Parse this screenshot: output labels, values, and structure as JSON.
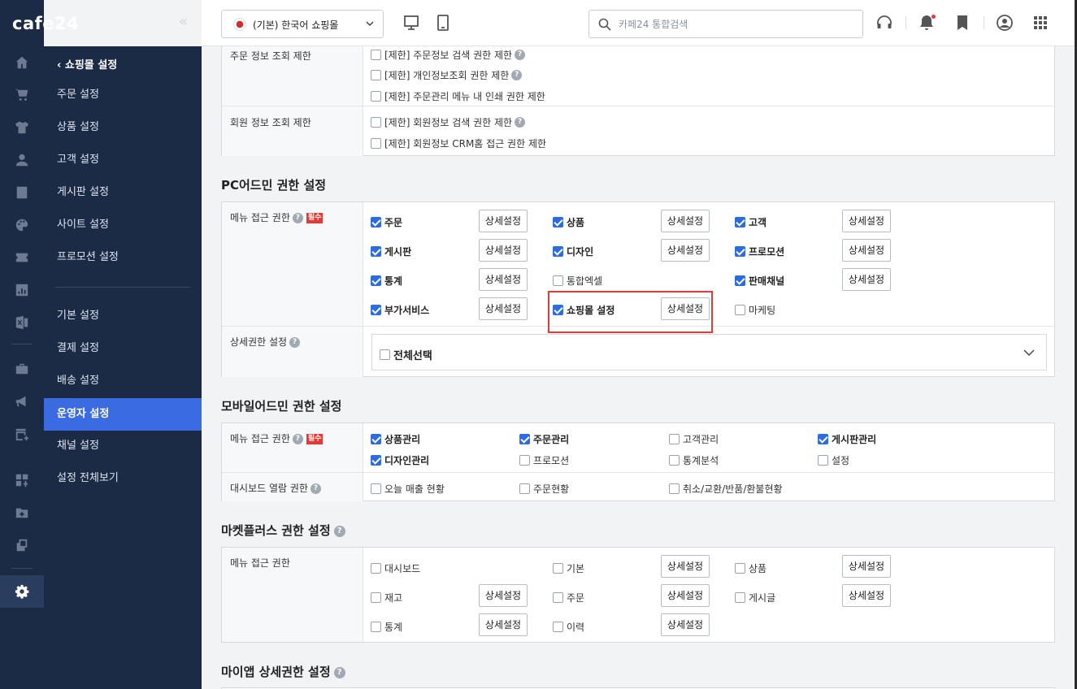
{
  "brand": {
    "logo": "cafe24",
    "collapse_icon": "«"
  },
  "topbar": {
    "store_select": "(기본) 한국어 쇼핑몰",
    "search_placeholder": "카페24 통합검색"
  },
  "sidebar": {
    "back_title": "쇼핑몰 설정",
    "items_top": [
      "주문 설정",
      "상품 설정",
      "고객 설정",
      "게시판 설정",
      "사이트 설정",
      "프로모션 설정"
    ],
    "items_bottom": [
      "기본 설정",
      "결제 설정",
      "배송 설정",
      "운영자 설정",
      "채널 설정",
      "설정 전체보기"
    ],
    "active": "운영자 설정"
  },
  "order_info": {
    "label": "주문 정보 조회 제한",
    "options": [
      "[제한] 주문정보 검색 권한 제한",
      "[제한] 개인정보조회 권한 제한",
      "[제한] 주문관리 메뉴 내 인쇄 권한 제한"
    ]
  },
  "member_info": {
    "label": "회원 정보 조회 제한",
    "options": [
      "[제한] 회원정보 검색 권한 제한",
      "[제한] 회원정보 CRM홈 접근 권한 제한"
    ]
  },
  "pc_admin": {
    "title": "PC어드민 권한 설정",
    "menu_label": "메뉴 접근 권한",
    "required": "필수",
    "detail_button": "상세설정",
    "items": [
      {
        "label": "주문",
        "checked": true
      },
      {
        "label": "상품",
        "checked": true
      },
      {
        "label": "고객",
        "checked": true
      },
      {
        "label": "게시판",
        "checked": true
      },
      {
        "label": "디자인",
        "checked": true
      },
      {
        "label": "프로모션",
        "checked": true
      },
      {
        "label": "통계",
        "checked": true
      },
      {
        "label": "통합엑셀",
        "checked": false
      },
      {
        "label": "판매채널",
        "checked": true
      },
      {
        "label": "부가서비스",
        "checked": true
      },
      {
        "label": "쇼핑몰 설정",
        "checked": true
      },
      {
        "label": "마케팅",
        "checked": false
      }
    ],
    "detail_label": "상세권한 설정",
    "select_all": "전체선택"
  },
  "mobile_admin": {
    "title": "모바일어드민 권한 설정",
    "menu_label": "메뉴 접근 권한",
    "required": "필수",
    "items": [
      {
        "label": "상품관리",
        "checked": true
      },
      {
        "label": "주문관리",
        "checked": true
      },
      {
        "label": "고객관리",
        "checked": false
      },
      {
        "label": "게시판관리",
        "checked": true
      },
      {
        "label": "디자인관리",
        "checked": true
      },
      {
        "label": "프로모션",
        "checked": false
      },
      {
        "label": "통계분석",
        "checked": false
      },
      {
        "label": "설정",
        "checked": false
      }
    ],
    "dashboard_label": "대시보드 열람 권한",
    "dashboard_items": [
      "오늘 매출 현황",
      "주문현황",
      "취소/교환/반품/환불현황"
    ]
  },
  "marketplus": {
    "title": "마켓플러스 권한 설정",
    "menu_label": "메뉴 접근 권한",
    "items": [
      "대시보드",
      "기본",
      "상품",
      "재고",
      "주문",
      "게시글",
      "통계",
      "이력"
    ]
  },
  "myapp": {
    "title": "마이앱 상세권한 설정"
  },
  "colors": {
    "sidebar_bg": "#1b2a45",
    "active_bg": "#3a6be0",
    "checkbox": "#2f6be0",
    "highlight": "#e53935"
  }
}
